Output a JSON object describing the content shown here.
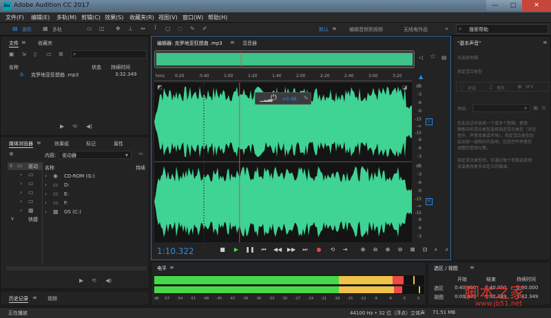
{
  "title_bar": {
    "app_icon": "Au",
    "title": "Adobe Audition CC 2017",
    "minimize": "—",
    "maximize": "□",
    "close": "✕"
  },
  "menu": [
    "文件(F)",
    "编辑(E)",
    "多轨(M)",
    "剪辑(C)",
    "效果(S)",
    "收藏夹(R)",
    "视图(V)",
    "窗口(W)",
    "帮助(H)"
  ],
  "toolbar": {
    "waveform_label": "波形",
    "multitrack_label": "多轨",
    "workspaces": [
      "默认",
      "编辑音频到视频",
      "无线电作品"
    ],
    "search_placeholder": "搜索帮助"
  },
  "files_panel": {
    "tabs": [
      "文件",
      "收藏夹"
    ],
    "columns": [
      "名称",
      "状态",
      "持续时间"
    ],
    "files": [
      {
        "name": "克罗地亚狂想曲 .mp3",
        "duration": "3:32.349"
      }
    ]
  },
  "media_browser": {
    "tabs": [
      "媒体浏览器",
      "效果组",
      "标记",
      "属性"
    ],
    "content_label": "内容:",
    "content_value": "驱动器",
    "tree": [
      "驱动",
      "快捷"
    ],
    "columns": [
      "名称",
      "持续"
    ],
    "drives": [
      "CD-ROM (G:)",
      "D:",
      "E:",
      "F:",
      "OS (C:)"
    ]
  },
  "history_panel": {
    "tabs": [
      "历史记录",
      "视频"
    ],
    "status": "正在播放"
  },
  "editor": {
    "tab": "编辑器: 克罗地亚狂想曲 .mp3",
    "mixer_tab": "混音器",
    "hud_gain": "+0 dB",
    "time_ticks": [
      "hms",
      "0:20",
      "0:40",
      "1:00",
      "1:20",
      "1:40",
      "2:00",
      "2:20",
      "2:40",
      "3:00",
      "3:20"
    ],
    "db_scale_top": [
      "dB",
      "-3",
      "-6",
      "-9",
      "-15",
      "-∞",
      "-15",
      "-9",
      "-6",
      "-3"
    ],
    "db_scale_bottom": [
      "dB",
      "-3",
      "-6",
      "-9",
      "-15",
      "-∞",
      "-15",
      "-9",
      "-6",
      "-3"
    ],
    "channel_top": "L",
    "channel_bottom": "R",
    "current_time": "1:10.322",
    "playhead_fraction": 0.331,
    "waveform_color": "#3fd394"
  },
  "essential_sound": {
    "title": "\"基本声音\"",
    "no_selection": "未选择剪辑",
    "preset_header": "指定混合类型",
    "categories": [
      "对话",
      "音乐",
      "SFX"
    ],
    "preset_label": "预设:",
    "description": [
      "在此会话中选择一个或多个剪辑。使用",
      "面板中的混合类型选择指定混合类型（对话",
      "音乐、声音效果或环境）。指定混合类型后",
      "会出现一组相应的选项。这些控件将使您",
      "调整的音频元素。",
      "",
      "指定混合类型后，可通过每个参数选择预",
      "设或更改更多自定义的微调。"
    ]
  },
  "level_meter": {
    "title": "电平",
    "scale": [
      "dB",
      "-57",
      "-54",
      "-51",
      "-48",
      "-45",
      "-42",
      "-39",
      "-36",
      "-33",
      "-30",
      "-27",
      "-24",
      "-21",
      "-18",
      "-15",
      "-12",
      "-9",
      "-6",
      "-3",
      "0"
    ],
    "green": "#45d94a",
    "yellow": "#f0c24a",
    "red": "#ee4848"
  },
  "selection_view": {
    "title": "选区 / 视图",
    "columns": [
      "开始",
      "结束",
      "持续时间"
    ],
    "rows": [
      {
        "label": "选区",
        "start": "0:40.000",
        "end": "0:40.000",
        "duration": "0:00.000"
      },
      {
        "label": "视图",
        "start": "0:00.000",
        "end": "3:32.349",
        "duration": "3:32.349"
      }
    ]
  },
  "status_bar": {
    "sample_rate": "44100 Hz • 32 位（浮点）",
    "channels": "立体声",
    "size": "71.51 MB"
  },
  "watermark": {
    "text": "脚本之家",
    "url": "www.jb51.net"
  }
}
